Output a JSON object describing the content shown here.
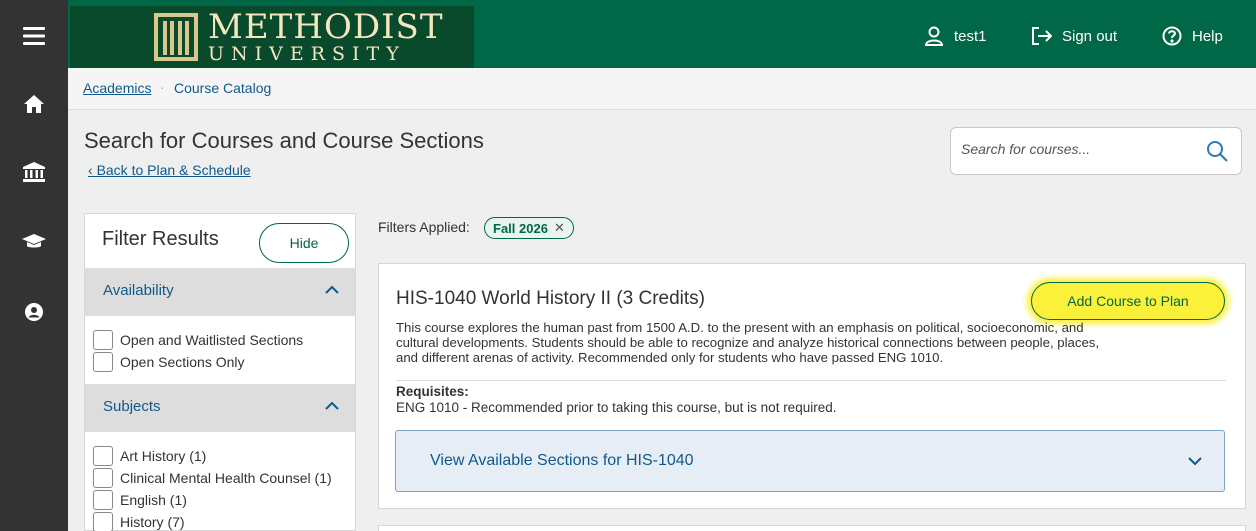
{
  "header": {
    "logo_line1": "METHODIST",
    "logo_line2": "UNIVERSITY",
    "user": "test1",
    "signout": "Sign out",
    "help": "Help"
  },
  "breadcrumb": {
    "item1": "Academics",
    "separator": "·",
    "item2": "Course Catalog"
  },
  "page": {
    "title": "Search for Courses and Course Sections",
    "back_link": "Back to Plan & Schedule",
    "search_placeholder": "Search for courses..."
  },
  "filters": {
    "title": "Filter Results",
    "hide_label": "Hide",
    "availability": {
      "label": "Availability",
      "options": [
        "Open and Waitlisted Sections",
        "Open Sections Only"
      ]
    },
    "subjects": {
      "label": "Subjects",
      "options": [
        "Art History (1)",
        "Clinical Mental Health Counsel (1)",
        "English (1)",
        "History (7)"
      ]
    }
  },
  "results": {
    "applied_label": "Filters Applied:",
    "chip": "Fall 2026",
    "course": {
      "title": "HIS-1040 World History II (3 Credits)",
      "add_label": "Add Course to Plan",
      "description_lines": [
        "This course explores the human past from 1500 A.D. to the present with an emphasis on political, socioeconomic, and",
        "cultural developments. Students should be able to recognize and analyze historical connections between people, places,",
        "and different arenas of activity. Recommended only for students who have passed ENG 1010."
      ],
      "requisites_label": "Requisites:",
      "requisites_text": "ENG 1010 - Recommended prior to taking this course, but is not required.",
      "sections_label": "View Available Sections for HIS-1040"
    }
  },
  "colors": {
    "brand_green": "#006747",
    "nav_dark": "#333333",
    "link_blue": "#0f5a8a",
    "highlight_yellow": "#fbf13a"
  },
  "icons": [
    "menu-icon",
    "home-icon",
    "institution-icon",
    "graduation-cap-icon",
    "user-circle-icon",
    "user-icon",
    "sign-out-icon",
    "help-icon",
    "search-icon",
    "chevron-up-icon",
    "chevron-down-icon",
    "close-icon"
  ]
}
